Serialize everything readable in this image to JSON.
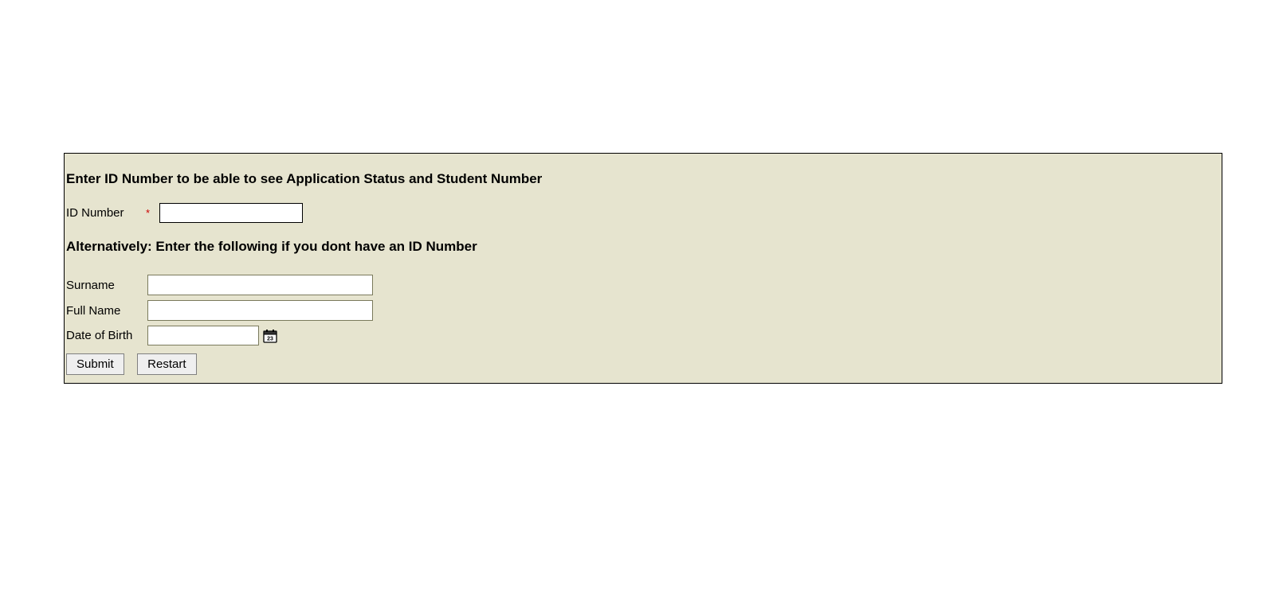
{
  "headings": {
    "id_prompt": "Enter ID Number to be able to see Application Status and Student Number",
    "alt_prompt": "Alternatively: Enter the following if you dont have an ID Number"
  },
  "fields": {
    "id_number": {
      "label": "ID Number",
      "required_mark": "*",
      "value": ""
    },
    "surname": {
      "label": "Surname",
      "value": ""
    },
    "full_name": {
      "label": "Full Name",
      "value": ""
    },
    "date_of_birth": {
      "label": "Date of Birth",
      "value": ""
    }
  },
  "buttons": {
    "submit": "Submit",
    "restart": "Restart"
  },
  "icons": {
    "calendar": "calendar-icon"
  }
}
